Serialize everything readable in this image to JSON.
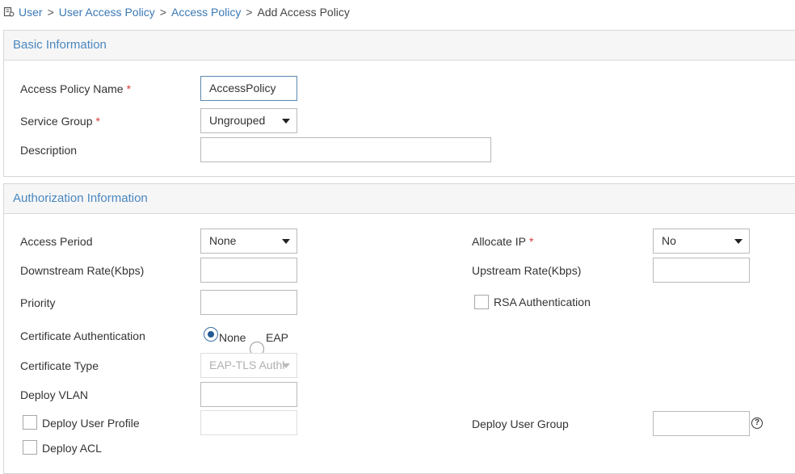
{
  "breadcrumb": {
    "icon": "user-policy-icon",
    "items": [
      "User",
      "User Access Policy",
      "Access Policy"
    ],
    "separator": ">",
    "current": "Add Access Policy"
  },
  "basic": {
    "title": "Basic Information",
    "policy_name_label": "Access Policy Name",
    "policy_name_value": "AccessPolicy",
    "service_group_label": "Service Group",
    "service_group_value": "Ungrouped",
    "description_label": "Description",
    "description_value": "",
    "required_mark": "*"
  },
  "auth": {
    "title": "Authorization Information",
    "access_period_label": "Access Period",
    "access_period_value": "None",
    "downstream_label": "Downstream Rate(Kbps)",
    "downstream_value": "",
    "priority_label": "Priority",
    "priority_value": "",
    "cert_auth_label": "Certificate Authentication",
    "cert_auth_options": [
      "None",
      "EAP"
    ],
    "cert_auth_selected": "None",
    "cert_type_label": "Certificate Type",
    "cert_type_value": "EAP-TLS Authl",
    "deploy_vlan_label": "Deploy VLAN",
    "deploy_vlan_value": "",
    "deploy_user_profile_label": "Deploy User Profile",
    "deploy_user_profile_value": "",
    "deploy_acl_label": "Deploy ACL",
    "allocate_ip_label": "Allocate IP",
    "allocate_ip_value": "No",
    "upstream_label": "Upstream Rate(Kbps)",
    "upstream_value": "",
    "rsa_label": "RSA Authentication",
    "deploy_user_group_label": "Deploy User Group",
    "deploy_user_group_value": "",
    "help_glyph": "?",
    "required_mark": "*"
  },
  "colors": {
    "link": "#3a78b4",
    "section_title": "#4a87bf",
    "required": "#d43a3a",
    "radio_checked": "#245a94"
  }
}
